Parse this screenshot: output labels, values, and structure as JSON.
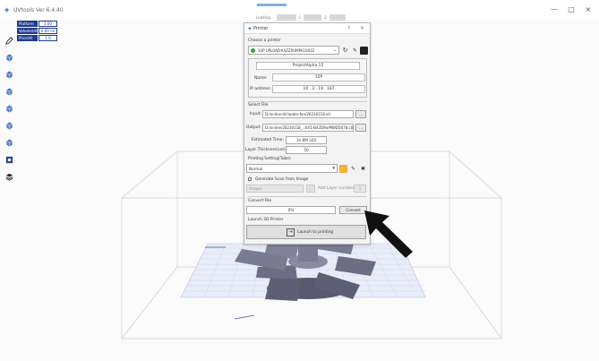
{
  "window": {
    "title": "UVtools Ver 6.4.40",
    "min_symbol": "—",
    "max_symbol": "□",
    "close_symbol": "×"
  },
  "top_tools": {
    "left_label": "Loading...",
    "mid_label": "1",
    "right_label": "2"
  },
  "info": {
    "rows": [
      {
        "key": "Platform",
        "value": "1.00"
      },
      {
        "key": "Volume(ml)",
        "value": "0.00 ml"
      },
      {
        "key": "Price(¥)",
        "value": "1.0"
      }
    ]
  },
  "dialog": {
    "title": "Printer",
    "help": "?",
    "close": "×",
    "choose_printer_label": "Choose a printer",
    "printer_value": "10P UPLOAD#AZZ0UMPA10032",
    "info_header": "ProjectAlpha 15",
    "name_label": "Name:",
    "name_value": "10P",
    "ip_label": "IP address:",
    "ip_value": "10 . 3 . 19 . 187",
    "select_file_label": "Select File",
    "input_label": "Input:",
    "input_value": "D:/online-dir/water-fan/20230118.stl",
    "output_label": "Output:",
    "output_value": "D:/online/20230118_..stl/1-B42D9a/MWD5678.ctb",
    "browse": "...",
    "estimated_label": "Estimated Time:",
    "estimated_value": "1h 8M 32S",
    "layer_label": "Layer Thickness(um):",
    "layer_value": "50",
    "printing_setting_label": "Printing Setting(Tube)",
    "printing_setting_value": "Normal",
    "generate_label": "Generate Scan from Image",
    "image_value": "Images",
    "add_layer_label": "Add Layer number",
    "add_layer_value": "1",
    "convert_file_label": "Convert File",
    "progress_text": "0%",
    "convert_button": "Convert",
    "launch_label": "Launch 3D Printer",
    "launch_button": "Launch to printing"
  }
}
